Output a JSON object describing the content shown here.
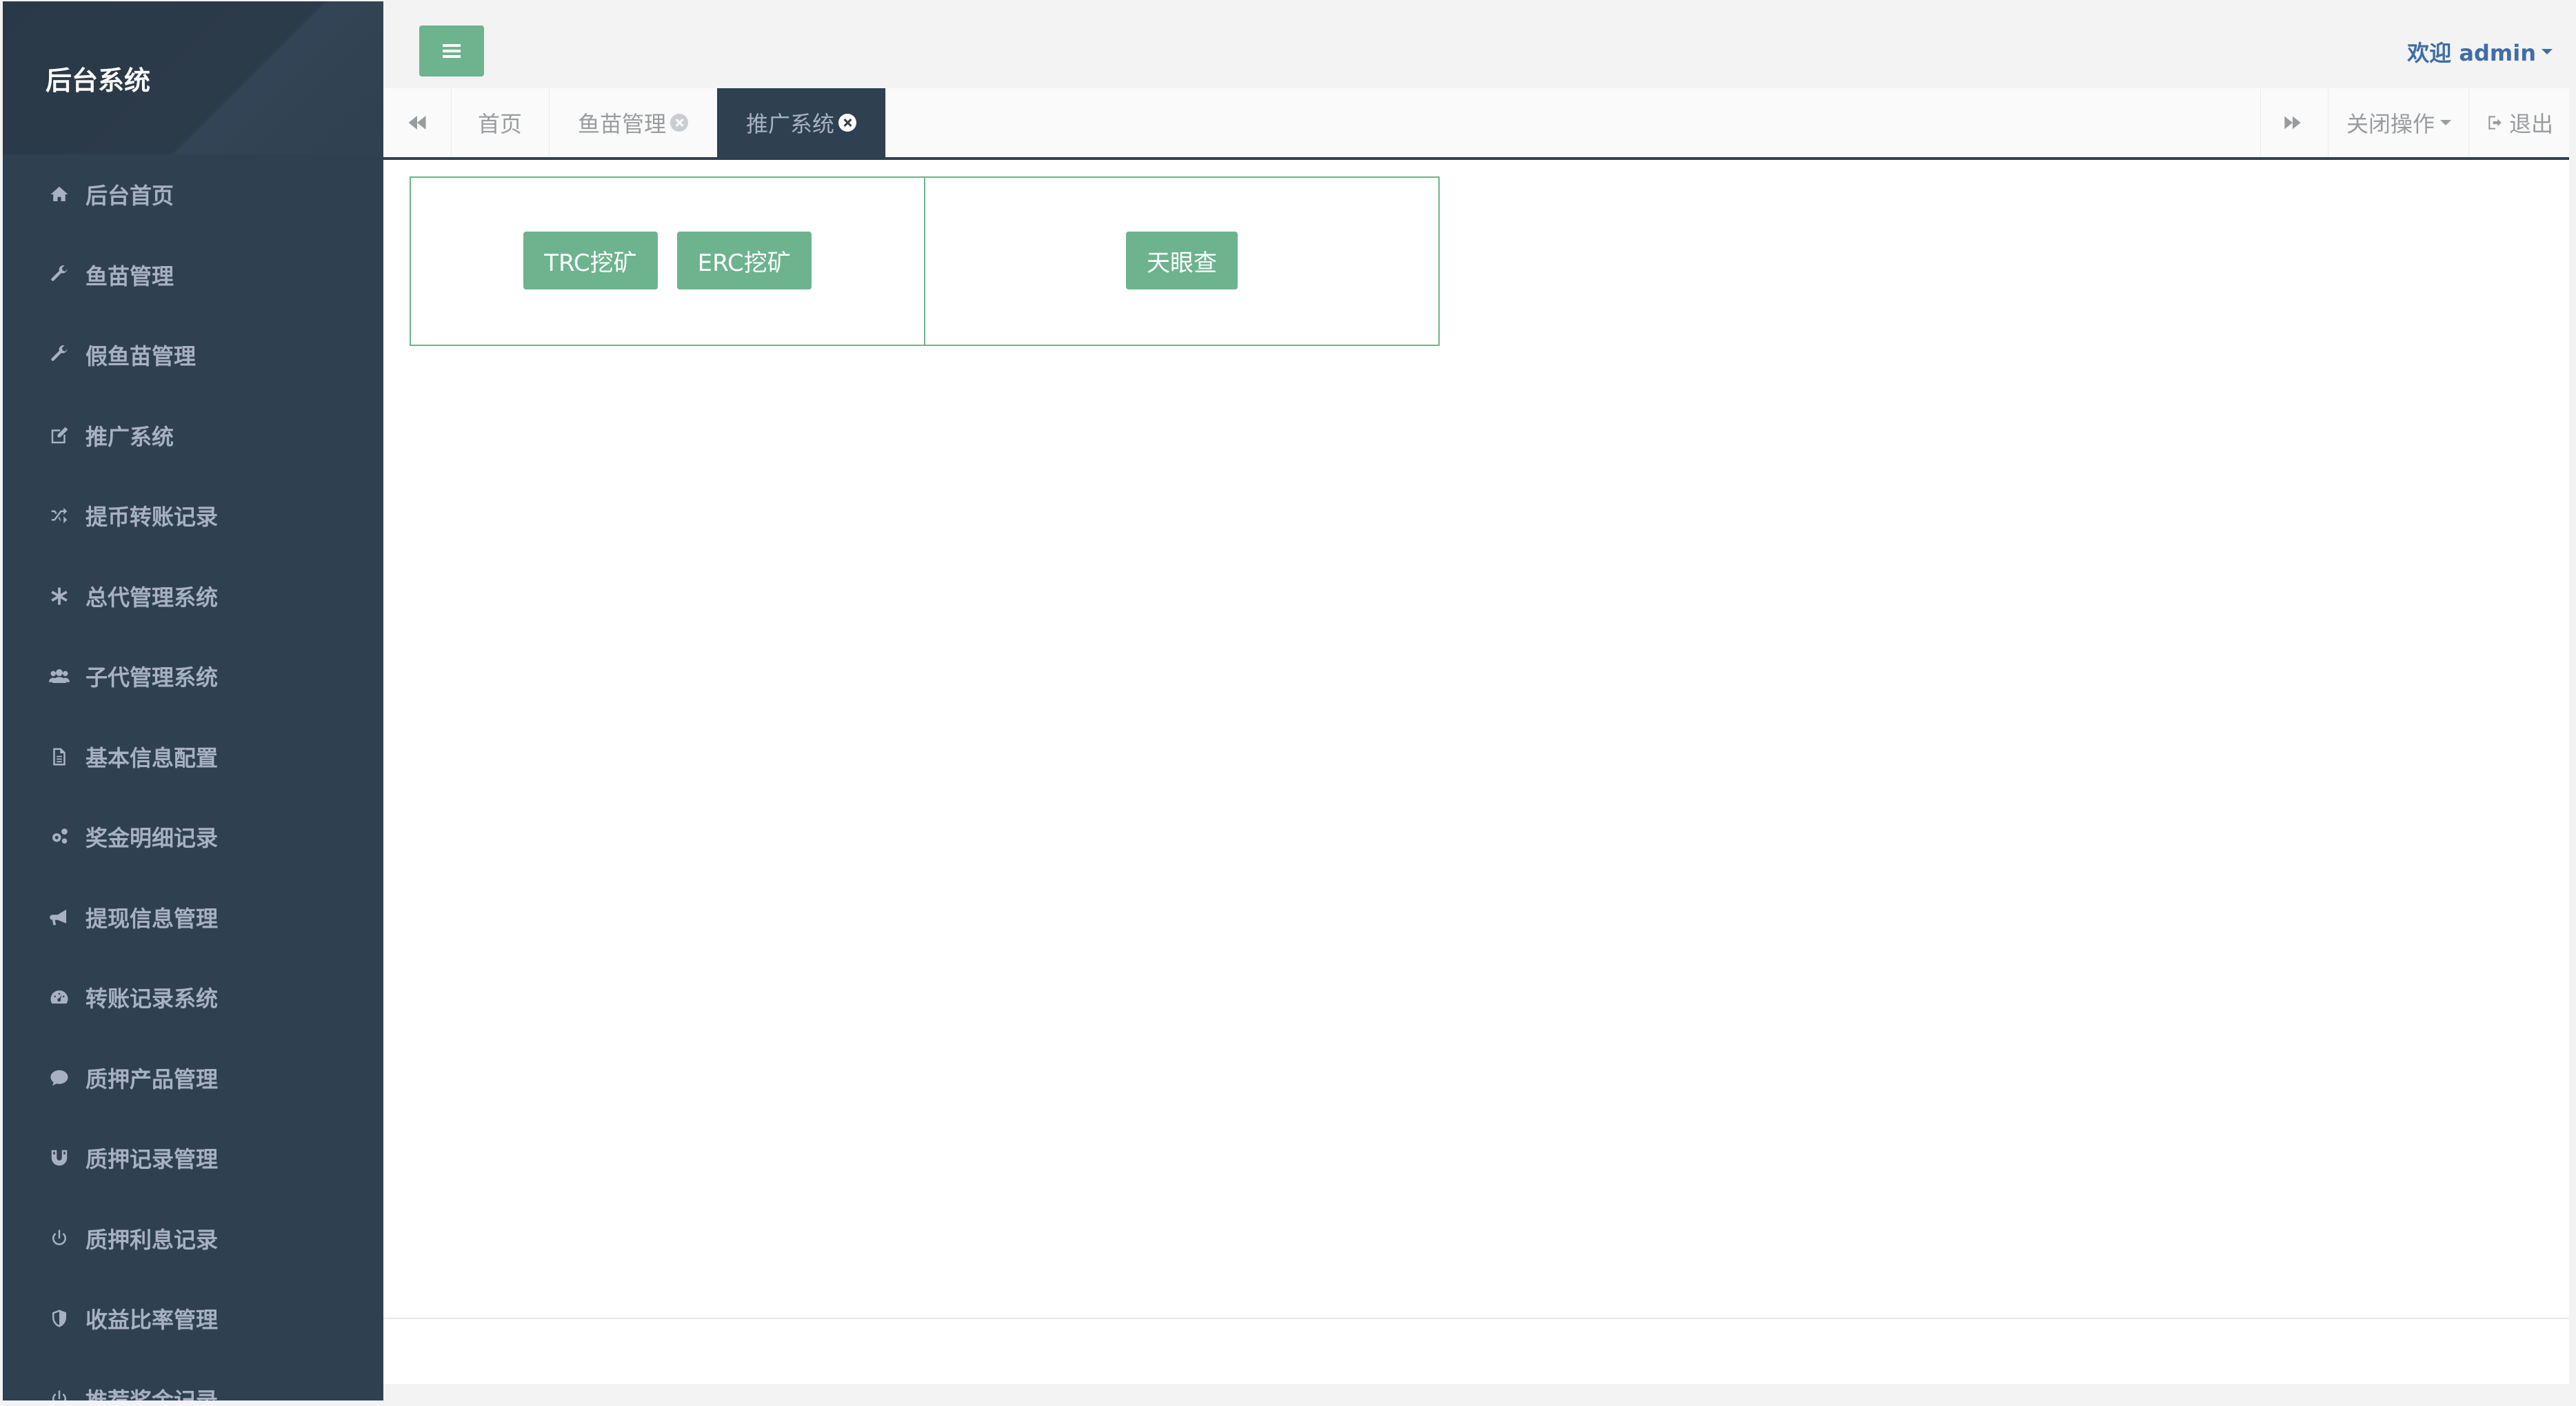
{
  "app": {
    "title": "后台系统"
  },
  "sidebar": {
    "items": [
      {
        "label": "后台首页",
        "icon": "home-icon"
      },
      {
        "label": "鱼苗管理",
        "icon": "wrench-icon"
      },
      {
        "label": "假鱼苗管理",
        "icon": "wrench-icon"
      },
      {
        "label": "推广系统",
        "icon": "edit-icon"
      },
      {
        "label": "提币转账记录",
        "icon": "shuffle-icon"
      },
      {
        "label": "总代管理系统",
        "icon": "asterisk-icon"
      },
      {
        "label": "子代管理系统",
        "icon": "users-icon"
      },
      {
        "label": "基本信息配置",
        "icon": "file-icon"
      },
      {
        "label": "奖金明细记录",
        "icon": "gears-icon"
      },
      {
        "label": "提现信息管理",
        "icon": "bullhorn-icon"
      },
      {
        "label": "转账记录系统",
        "icon": "dashboard-icon"
      },
      {
        "label": "质押产品管理",
        "icon": "comment-icon"
      },
      {
        "label": "质押记录管理",
        "icon": "magnet-icon"
      },
      {
        "label": "质押利息记录",
        "icon": "power-icon"
      },
      {
        "label": "收益比率管理",
        "icon": "shield-icon"
      },
      {
        "label": "推荐奖金记录",
        "icon": "power-icon"
      }
    ]
  },
  "header": {
    "welcome": "欢迎 admin"
  },
  "tabs": [
    {
      "label": "首页",
      "closable": false,
      "active": false
    },
    {
      "label": "鱼苗管理",
      "closable": true,
      "active": false
    },
    {
      "label": "推广系统",
      "closable": true,
      "active": true
    }
  ],
  "tab_tools": {
    "close_ops": "关闭操作",
    "logout": "退出"
  },
  "main": {
    "left_panel_buttons": [
      "TRC挖矿",
      "ERC挖矿"
    ],
    "right_panel_buttons": [
      "天眼查"
    ]
  },
  "colors": {
    "sidebar_bg": "#2f4050",
    "accent": "#6db38e",
    "link": "#3f6da6"
  }
}
